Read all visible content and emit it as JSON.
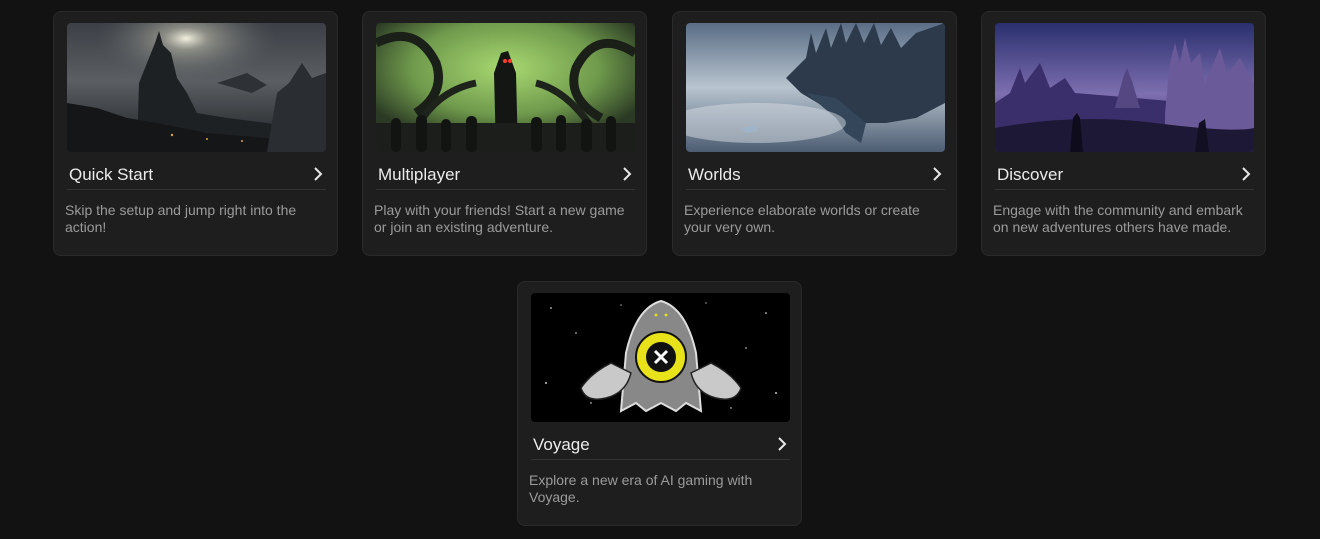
{
  "cards": [
    {
      "id": "quick-start",
      "title": "Quick Start",
      "description": "Skip the setup and jump right into the action!",
      "image": "dark-castle-landscape"
    },
    {
      "id": "multiplayer",
      "title": "Multiplayer",
      "description": "Play with your friends! Start a new game or join an existing adventure.",
      "image": "tentacle-monster-silhouettes"
    },
    {
      "id": "worlds",
      "title": "Worlds",
      "description": "Experience elaborate worlds or create your very own.",
      "image": "floating-city-in-mist"
    },
    {
      "id": "discover",
      "title": "Discover",
      "description": "Engage with the community and embark on new adventures others have made.",
      "image": "purple-fantasy-castles"
    },
    {
      "id": "voyage",
      "title": "Voyage",
      "description": "Explore a new era of AI gaming with Voyage.",
      "image": "ghost-with-hands-holding-yellow-orb"
    }
  ],
  "colors": {
    "background": "#121212",
    "card": "#1e1e1e",
    "title": "#ececec",
    "description": "#9b9b9b",
    "accent_yellow": "#e8e21a"
  }
}
